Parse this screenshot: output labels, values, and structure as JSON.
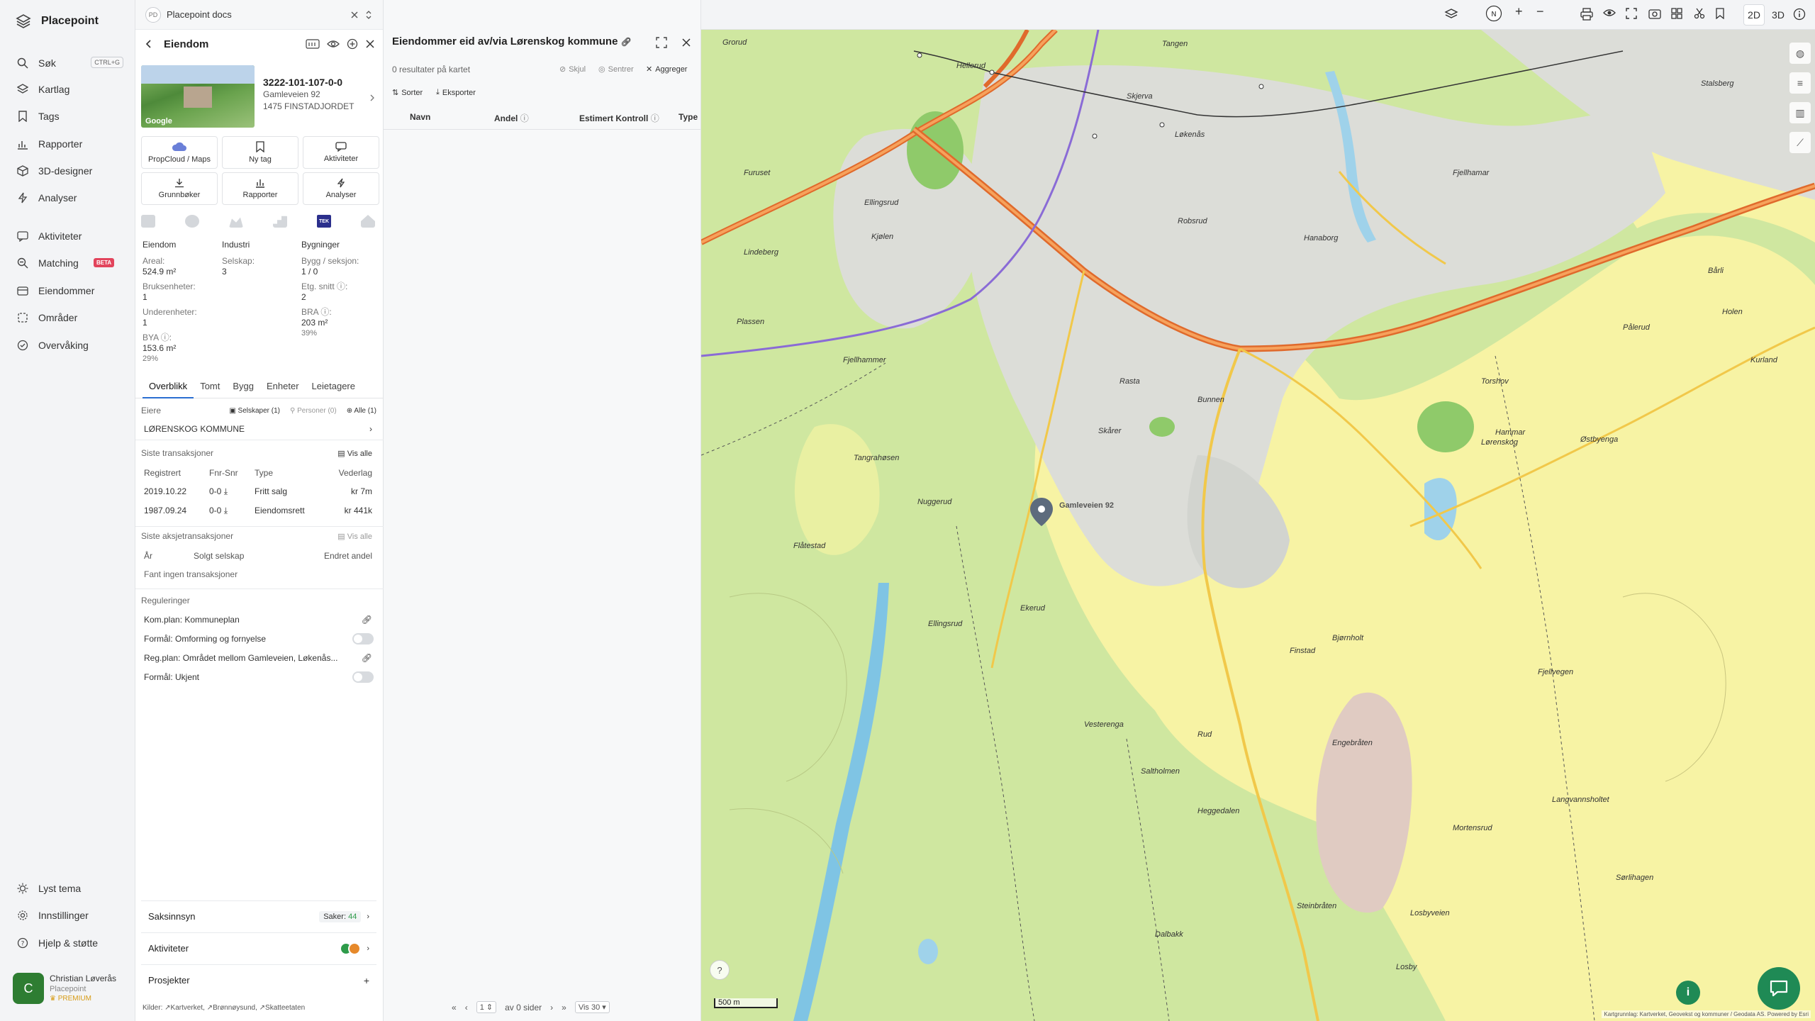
{
  "app": {
    "name": "Placepoint"
  },
  "nav": {
    "items": [
      {
        "label": "Søk",
        "shortcut": "CTRL+G"
      },
      {
        "label": "Kartlag"
      },
      {
        "label": "Tags"
      },
      {
        "label": "Rapporter"
      },
      {
        "label": "3D-designer"
      },
      {
        "label": "Analyser"
      },
      {
        "label": "Aktiviteter"
      },
      {
        "label": "Matching",
        "badge": "BETA"
      },
      {
        "label": "Eiendommer"
      },
      {
        "label": "Områder"
      },
      {
        "label": "Overvåking"
      }
    ],
    "bottom": [
      {
        "label": "Lyst tema"
      },
      {
        "label": "Innstillinger"
      },
      {
        "label": "Hjelp & støtte"
      }
    ],
    "user": {
      "initial": "C",
      "name": "Christian Løverås",
      "org": "Placepoint",
      "plan": "PREMIUM"
    }
  },
  "prop": {
    "workspace_badge": "PD",
    "workspace_title": "Placepoint docs",
    "header": "Eiendom",
    "thumb_label": "Google",
    "id": "3222-101-107-0-0",
    "addr1": "Gamleveien 92",
    "addr2": "1475 FINSTADJORDET",
    "actions": [
      "PropCloud / Maps",
      "Ny tag",
      "Aktiviteter",
      "Grunnbøker",
      "Rapporter",
      "Analyser"
    ],
    "tek_label": "TEK",
    "stats": {
      "c1_title": "Eiendom",
      "areal_lbl": "Areal:",
      "areal_val": "524.9 m²",
      "bruks_lbl": "Bruksenheter:",
      "bruks_val": "1",
      "under_lbl": "Underenheter:",
      "under_val": "1",
      "bya_lbl": "BYA ⓘ:",
      "bya_val": "153.6 m²",
      "bya_pct": "29%",
      "c2_title": "Industri",
      "selskap_lbl": "Selskap:",
      "selskap_val": "3",
      "c3_title": "Bygninger",
      "bygg_lbl": "Bygg / seksjon:",
      "bygg_val": "1 / 0",
      "etg_lbl": "Etg. snitt ⓘ:",
      "etg_val": "2",
      "bra_lbl": "BRA ⓘ:",
      "bra_val": "203 m²",
      "bra_pct": "39%"
    },
    "tabs": [
      "Overblikk",
      "Tomt",
      "Bygg",
      "Enheter",
      "Leietagere"
    ],
    "owners": {
      "label": "Eiere",
      "f1": "Selskaper (1)",
      "f2": "Personer (0)",
      "f3": "Alle (1)",
      "owner": "LØRENSKOG KOMMUNE"
    },
    "tx": {
      "label": "Siste transaksjoner",
      "vis_alle": "Vis alle",
      "headers": [
        "Registrert",
        "Fnr-Snr",
        "Type",
        "Vederlag"
      ],
      "rows": [
        {
          "date": "2019.10.22",
          "fnr": "0-0",
          "type": "Fritt salg",
          "amount": "kr 7m"
        },
        {
          "date": "1987.09.24",
          "fnr": "0-0",
          "type": "Eiendomsrett",
          "amount": "kr 441k"
        }
      ]
    },
    "stx": {
      "label": "Siste aksjetransaksjoner",
      "vis_alle": "Vis alle",
      "headers": [
        "År",
        "Solgt selskap",
        "Endret andel"
      ],
      "empty": "Fant ingen transaksjoner"
    },
    "reg": {
      "label": "Reguleringer",
      "r1": "Kom.plan: Kommuneplan",
      "r2": "Formål: Omforming og fornyelse",
      "r3": "Reg.plan: Området mellom Gamleveien, Løkenås...",
      "r4": "Formål: Ukjent"
    },
    "bottom": [
      {
        "label": "Saksinnsyn",
        "count_lbl": "Saker:",
        "count": "44"
      },
      {
        "label": "Aktiviteter"
      },
      {
        "label": "Prosjekter"
      }
    ],
    "sources": {
      "label": "Kilder:",
      "items": [
        "Kartverket,",
        "Brønnøysund,",
        "Skatteetaten"
      ]
    }
  },
  "list": {
    "title": "Eiendommer eid av/via Lørenskog kommune",
    "summary": "0 resultater på kartet",
    "skjul": "Skjul",
    "sentrer": "Sentrer",
    "aggreger": "Aggreger",
    "sorter": "Sorter",
    "eksporter": "Eksporter",
    "columns": [
      "Navn",
      "Andel",
      "Estimert Kontroll",
      "Type"
    ],
    "pager": {
      "page": "1",
      "of": "av 0 sider",
      "per": "Vis 30"
    }
  },
  "map": {
    "modes": [
      "2D",
      "3D"
    ],
    "scale": "500 m",
    "attribution": "Kartgrunnlag: Kartverket, Geovekst og kommuner / Geodata AS. Powered by Esri",
    "marker_label": "Gamleveien 92",
    "places": [
      "Grorud",
      "Hellerud",
      "Skjerva",
      "Tangen",
      "Furuset",
      "Ellingsrud",
      "Kjølen",
      "Lindeberg",
      "Plassen",
      "Løkenås",
      "Robsrud",
      "Hanaborg",
      "Fjellhamar",
      "Stalsberg",
      "Bårli",
      "Holen",
      "Pålerud",
      "Kurland",
      "Torshov",
      "Hammar",
      "Østbyenga",
      "Skårer",
      "Rasta",
      "Bunnen",
      "Lørenskog",
      "Tangrahøsen",
      "Nuggerud",
      "Flåtestad",
      "Ellingsrud",
      "Losby",
      "Finstad",
      "Fjellvegen",
      "Rud",
      "Vesterenga",
      "Ekerud",
      "Bjørnholt",
      "Engebråten",
      "Steinbråten",
      "Mortensrud",
      "Losbyveien",
      "Dalbakk",
      "Langvannsholtet",
      "Sørlihagen",
      "Heggedalen",
      "Fjellhammer",
      "Saltholmen"
    ]
  }
}
